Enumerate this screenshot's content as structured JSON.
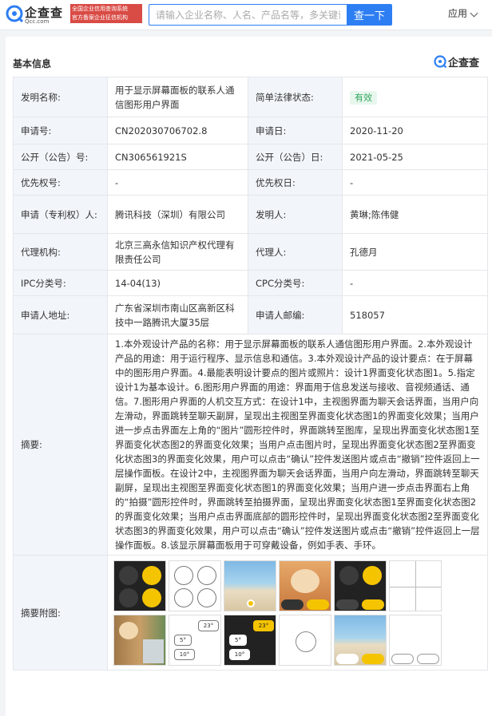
{
  "header": {
    "logo_cn": "企查查",
    "logo_en": "Qcc.com",
    "tagline_line1": "全国企业信用查询系统",
    "tagline_line2": "官方备案企业征信机构",
    "search_placeholder": "请输入企业名称、人名、产品名等，多关键词",
    "search_button": "查一下",
    "app_menu": "应用"
  },
  "section": {
    "title": "基本信息",
    "brand": "企查查"
  },
  "info": {
    "invention_name_label": "发明名称:",
    "invention_name": "用于显示屏幕面板的联系人通信图形用户界面",
    "legal_status_label": "简单法律状态:",
    "legal_status": "有效",
    "application_no_label": "申请号:",
    "application_no": "CN202030706702.8",
    "application_date_label": "申请日:",
    "application_date": "2020-11-20",
    "publication_no_label": "公开（公告）号:",
    "publication_no": "CN306561921S",
    "publication_date_label": "公开（公告）日:",
    "publication_date": "2021-05-25",
    "priority_no_label": "优先权号:",
    "priority_no": "-",
    "priority_date_label": "优先权日:",
    "priority_date": "-",
    "applicant_label": "申请（专利权）人:",
    "applicant": "腾讯科技（深圳）有限公司",
    "inventor_label": "发明人:",
    "inventor": "黄琳;陈伟健",
    "agency_label": "代理机构:",
    "agency": "北京三高永信知识产权代理有限责任公司",
    "agent_label": "代理人:",
    "agent": "孔德月",
    "ipc_label": "IPC分类号:",
    "ipc": "14-04(13)",
    "cpc_label": "CPC分类号:",
    "cpc": "-",
    "address_label": "申请人地址:",
    "address": "广东省深圳市南山区高新区科技中一路腾讯大厦35层",
    "postcode_label": "申请人邮编:",
    "postcode": "518057",
    "abstract_label": "摘要:",
    "abstract": "1.本外观设计产品的名称：用于显示屏幕面板的联系人通信图形用户界面。2.本外观设计产品的用途：用于运行程序、显示信息和通信。3.本外观设计产品的设计要点：在于屏幕中的图形用户界面。4.最能表明设计要点的图片或照片：设计1界面变化状态图1。5.指定设计1为基本设计。6.图形用户界面的用途：界面用于信息发送与接收、音视频通话、通信。7.图形用户界面的人机交互方式：在设计1中，主视图界面为聊天会话界面，当用户向左滑动，界面跳转至聊天副屏，呈现出主视图至界面变化状态图1的界面变化效果；当用户进一步点击界面左上角的“图片”圆形控件时，界面跳转至图库，呈现出界面变化状态图1至界面变化状态图2的界面变化效果；当用户点击图片时，呈现出界面变化状态图2至界面变化状态图3的界面变化效果，用户可以点击“确认”控件发送图片或点击“撤销”控件返回上一层操作面板。在设计2中，主视图界面为聊天会话界面，当用户向左滑动，界面跳转至聊天副屏，呈现出主视图至界面变化状态图1的界面变化效果；当用户进一步点击界面右上角的“拍摄”圆形控件时，界面跳转至拍摄界面，呈现出界面变化状态图1至界面变化状态图2的界面变化效果；当用户点击界面底部的圆形控件时，呈现出界面变化状态图2至界面变化状态图3的界面变化效果，用户可以点击“确认”控件发送图片或点击“撤销”控件返回上一层操作面板。8.该显示屏幕面板用于可穿戴设备，例如手表、手环。",
    "figures_label": "摘要附图:"
  },
  "thumbnails": {
    "bubble_23": "23°",
    "bubble_5": "5°",
    "bubble_10": "10°"
  },
  "colors": {
    "accent": "#2e7ef3",
    "valid_green": "#2fa55a",
    "watch_yellow": "#f5c400",
    "label_bg": "#f2f6fb"
  }
}
